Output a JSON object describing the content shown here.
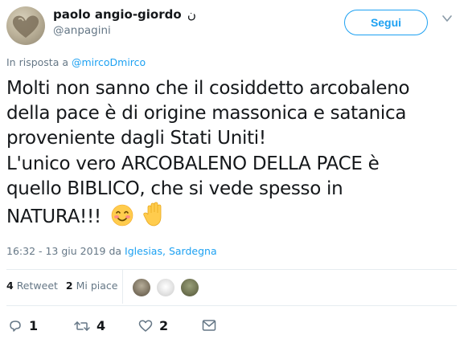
{
  "author": {
    "display_name": "paolo angio-giordo",
    "name_suffix": "ن",
    "handle": "@anpagini"
  },
  "follow_button": "Segui",
  "reply_context": {
    "prefix": "In risposta a",
    "mention": "@mircoDmirco"
  },
  "tweet": {
    "lines": [
      "Molti non sanno che il cosiddetto arcobaleno",
      "della pace è di origine massonica e satanica",
      "proveniente dagli Stati Uniti!",
      "L'unico vero ARCOBALENO DELLA PACE è",
      "quello BIBLICO, che si vede spesso in",
      "NATURA!!!"
    ],
    "emojis": [
      "smiling-face-emoji",
      "raised-hand-emoji"
    ]
  },
  "meta": {
    "time": "16:32 - 13 giu 2019 da",
    "place_city": "Iglesias",
    "place_sep": ",",
    "place_region": "Sardegna"
  },
  "stats": {
    "retweets_count": "4",
    "retweets_label": "Retweet",
    "likes_count": "2",
    "likes_label": "Mi piace"
  },
  "actions": {
    "reply_count": "1",
    "retweet_count": "4",
    "like_count": "2"
  },
  "colors": {
    "accent": "#1da1f2",
    "secondary_text": "#657786",
    "divider": "#e6ecf0"
  }
}
